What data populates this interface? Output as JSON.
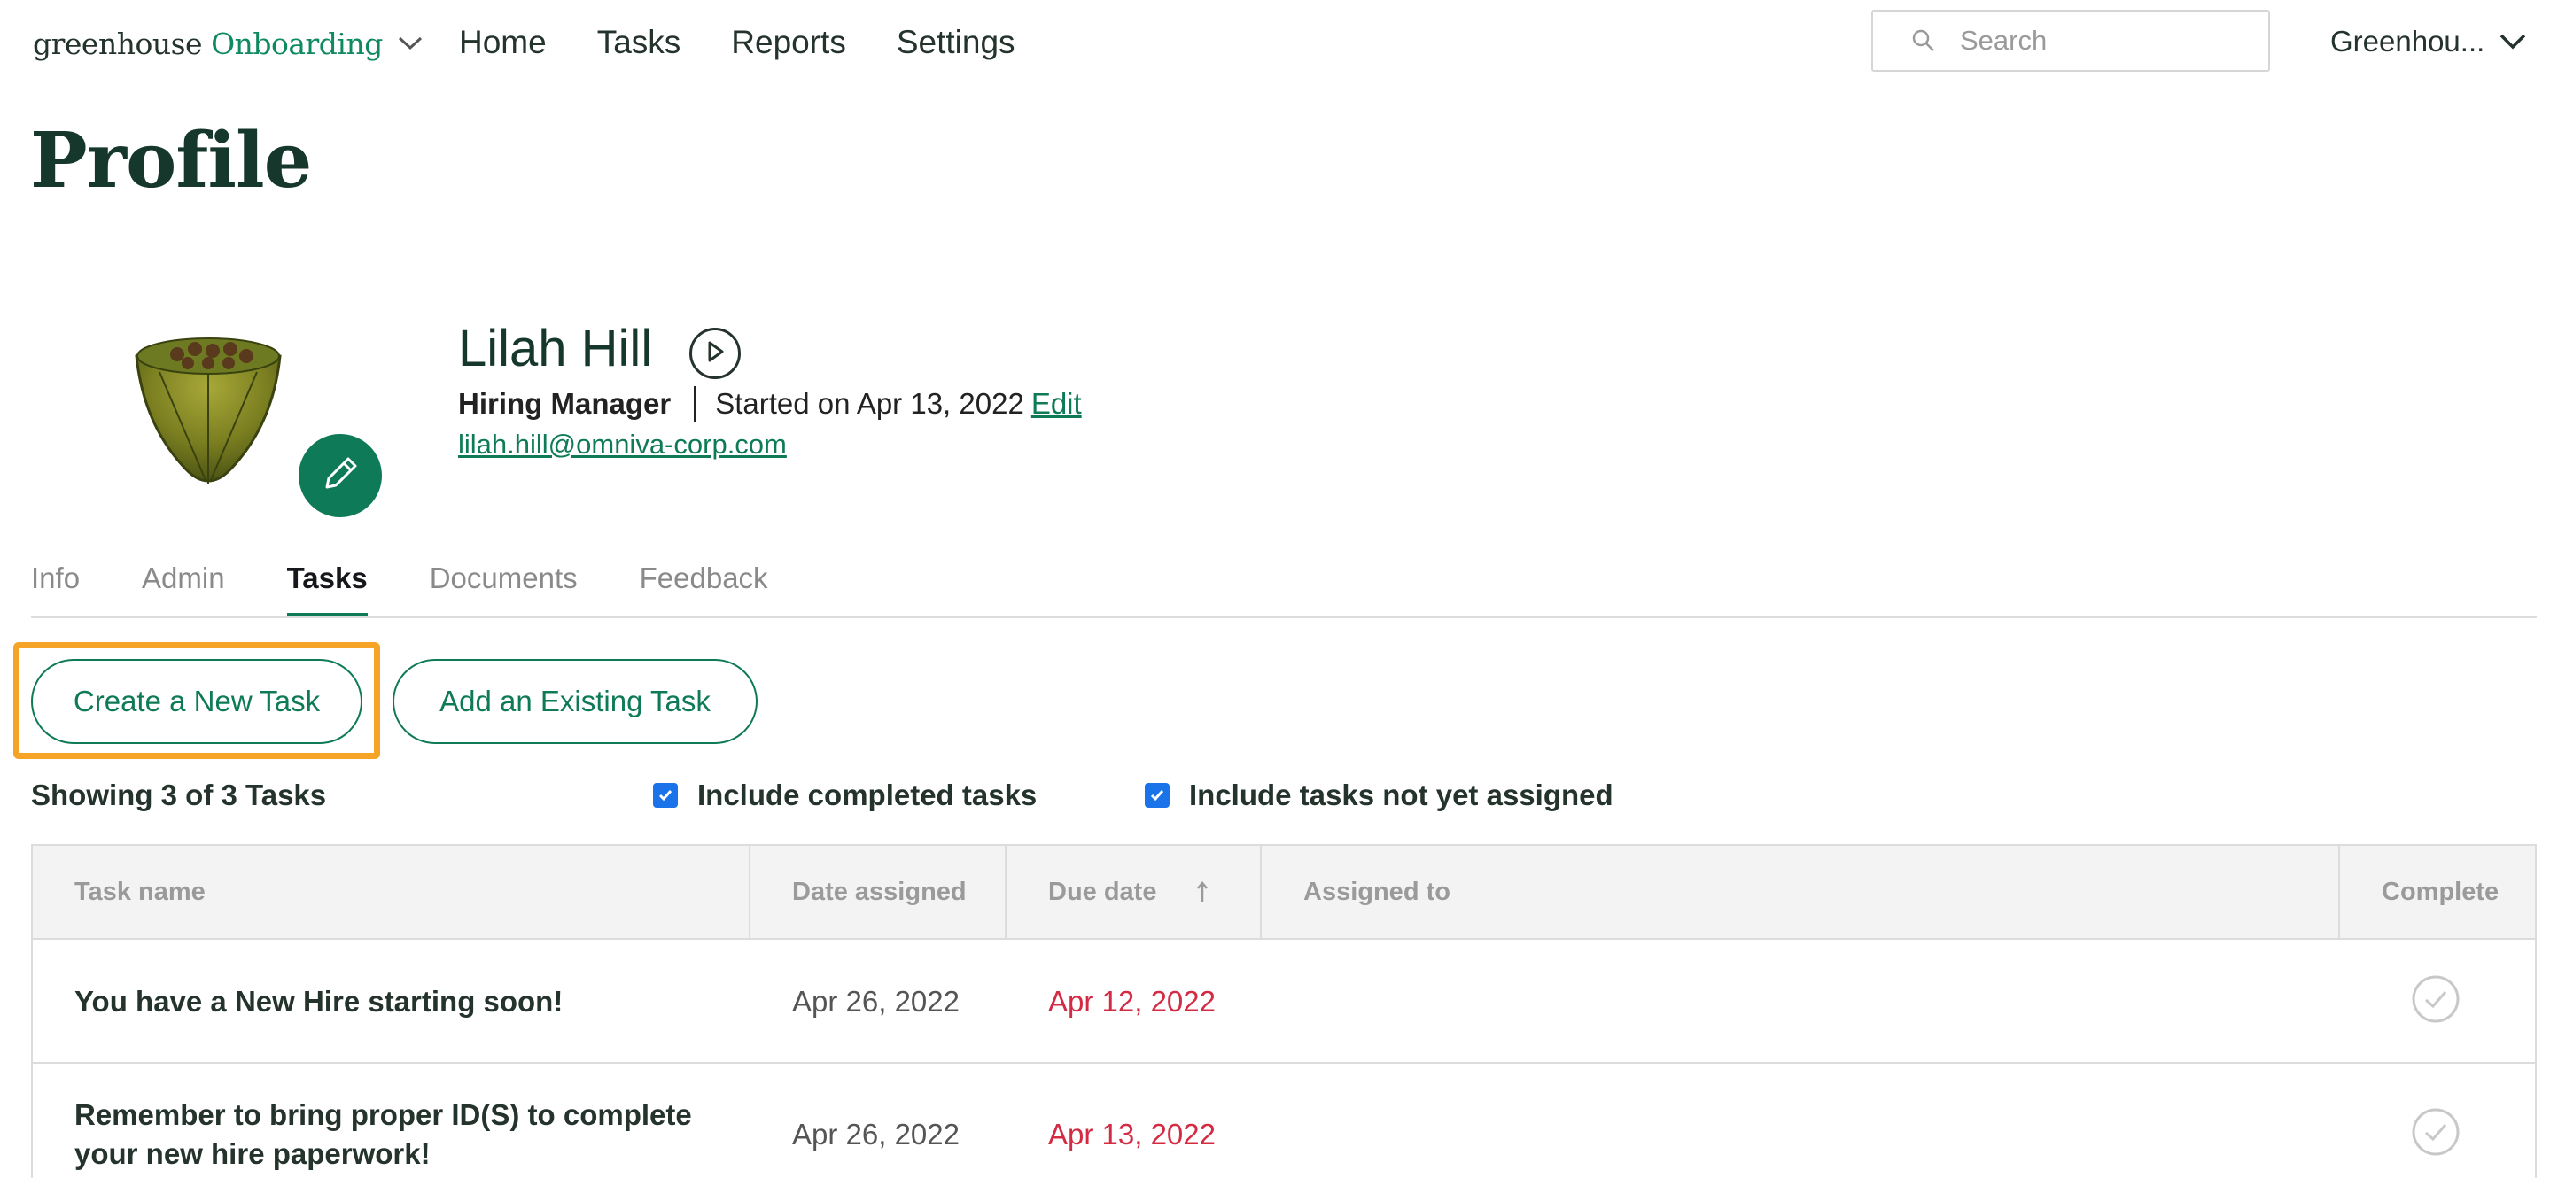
{
  "nav": {
    "brand": "greenhouse",
    "product": "Onboarding",
    "links": [
      "Home",
      "Tasks",
      "Reports",
      "Settings"
    ],
    "search_placeholder": "Search",
    "account_name": "Greenhou..."
  },
  "page": {
    "title": "Profile"
  },
  "profile": {
    "name": "Lilah Hill",
    "role": "Hiring Manager",
    "started": "Started on Apr 13, 2022",
    "edit_label": "Edit",
    "email": "lilah.hill@omniva-corp.com"
  },
  "tabs": [
    "Info",
    "Admin",
    "Tasks",
    "Documents",
    "Feedback"
  ],
  "active_tab": "Tasks",
  "actions": {
    "create_label": "Create a New Task",
    "add_existing_label": "Add an Existing Task"
  },
  "filters": {
    "showing": "Showing 3 of 3 Tasks",
    "include_completed": {
      "label": "Include completed tasks",
      "checked": true
    },
    "include_unassigned": {
      "label": "Include tasks not yet assigned",
      "checked": true
    }
  },
  "table": {
    "headers": [
      "Task name",
      "Date assigned",
      "Due date",
      "Assigned to",
      "Complete"
    ],
    "rows": [
      {
        "task": "You have a New Hire starting soon!",
        "date_assigned": "Apr 26, 2022",
        "due_date": "Apr 12, 2022",
        "assigned_to": "",
        "complete": false
      },
      {
        "task": "Remember to bring proper ID(S) to complete your new hire paperwork!",
        "date_assigned": "Apr 26, 2022",
        "due_date": "Apr 13, 2022",
        "assigned_to": "",
        "complete": false
      }
    ]
  },
  "colors": {
    "brand_green": "#0f7a57",
    "highlight": "#f5a428",
    "overdue_red": "#d22b43",
    "checkbox_blue": "#1a73e8"
  }
}
